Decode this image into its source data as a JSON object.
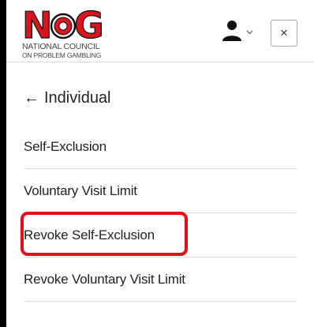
{
  "logo": {
    "line1": "NATIONAL COUNCIL",
    "line2": "ON PROBLEM GAMBLING",
    "colors": {
      "letters": "#d9141e",
      "outline": "#111111",
      "o_fill": "#d9141e"
    }
  },
  "header": {
    "user_icon": "user-icon",
    "chevron_icon": "chevron-down-icon",
    "close_label": "×"
  },
  "nav": {
    "back_arrow": "←",
    "back_label": "Individual"
  },
  "menu": {
    "items": [
      {
        "label": "Self-Exclusion"
      },
      {
        "label": "Voluntary Visit Limit"
      },
      {
        "label": "Revoke Self-Exclusion",
        "highlighted": true
      },
      {
        "label": "Revoke Voluntary Visit Limit"
      }
    ]
  },
  "colors": {
    "highlight": "#e3101c",
    "text": "#222222",
    "divider": "#dddddd"
  }
}
